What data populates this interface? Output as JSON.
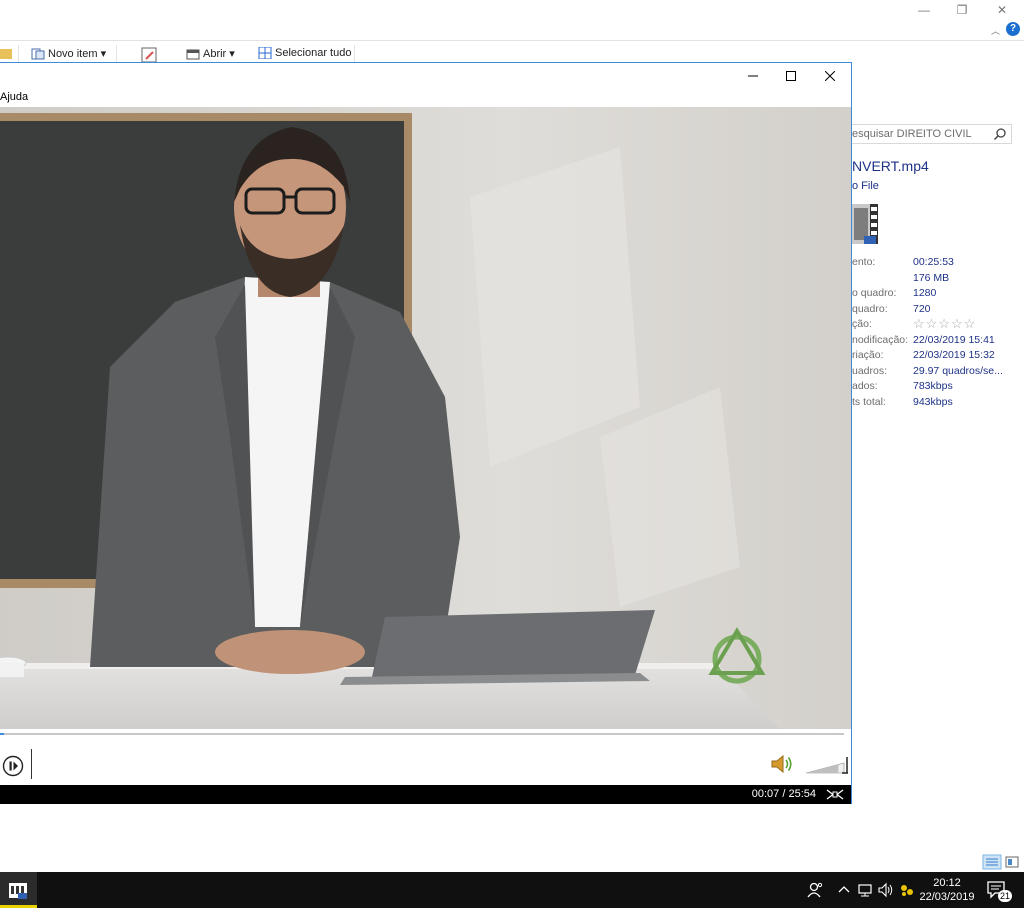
{
  "explorer": {
    "window_controls": {
      "minimize": "—",
      "maximize": "❐",
      "close": "✕"
    },
    "help": "?",
    "ribbon": {
      "new_item": "Novo item ▾",
      "open": "Abrir ▾",
      "select_all": "Selecionar tudo"
    },
    "search_placeholder": "esquisar DIREITO CIVIL",
    "details": {
      "file_name": "NVERT.mp4",
      "file_type": "o File",
      "properties": [
        {
          "label": "ento:",
          "value": "00:25:53"
        },
        {
          "label": "",
          "value": "176 MB"
        },
        {
          "label": "o quadro:",
          "value": "1280"
        },
        {
          "label": "quadro:",
          "value": "720"
        },
        {
          "label": "ção:",
          "value": "☆☆☆☆☆"
        },
        {
          "label": "nodificação:",
          "value": "22/03/2019 15:41"
        },
        {
          "label": "riação:",
          "value": "22/03/2019 15:32"
        },
        {
          "label": "uadros:",
          "value": "29.97 quadros/se..."
        },
        {
          "label": "ados:",
          "value": "783kbps"
        },
        {
          "label": "ts total:",
          "value": "943kbps"
        }
      ]
    }
  },
  "player": {
    "menu": {
      "help": "Ajuda"
    },
    "time": "00:07 / 25:54",
    "progress": 0.0045,
    "volume_level": 0.85
  },
  "taskbar": {
    "time": "20:12",
    "date": "22/03/2019",
    "notification_count": "21"
  }
}
